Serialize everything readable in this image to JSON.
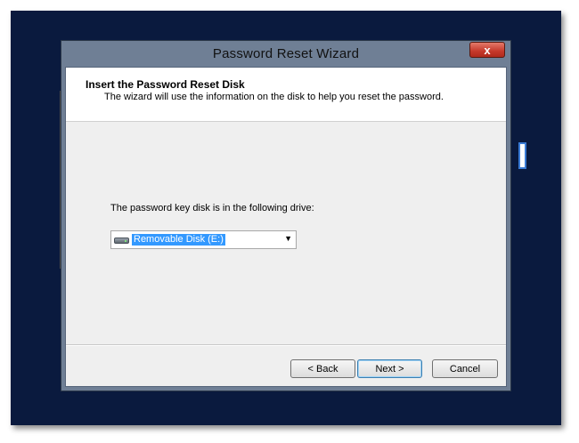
{
  "window": {
    "title": "Password Reset Wizard",
    "close_label": "x"
  },
  "header": {
    "title": "Insert the Password Reset Disk",
    "subtitle": "The wizard will use the information on the disk to help you reset the password."
  },
  "main": {
    "prompt": "The password key disk is in the following drive:",
    "drive_select": {
      "selected": "Removable Disk (E:)",
      "icon": "removable-drive-icon"
    }
  },
  "footer": {
    "back_label": "< Back",
    "next_label": "Next >",
    "cancel_label": "Cancel"
  },
  "colors": {
    "desktop_background": "#0a1a3e",
    "selection_highlight": "#3399ff",
    "close_button": "#c5382a"
  }
}
